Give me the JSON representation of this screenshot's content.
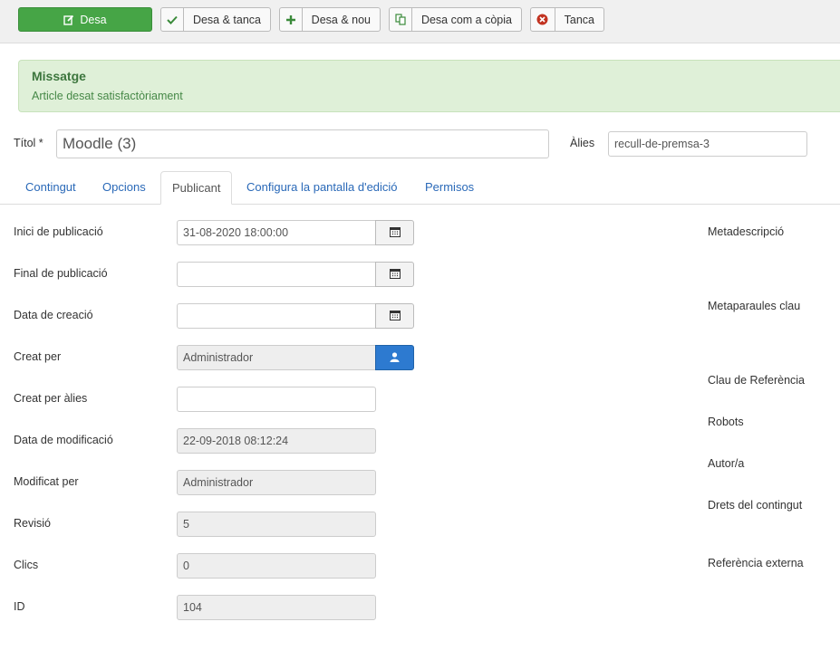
{
  "toolbar": {
    "save": "Desa",
    "save_close": "Desa & tanca",
    "save_new": "Desa & nou",
    "save_copy": "Desa com a còpia",
    "close": "Tanca"
  },
  "alert": {
    "heading": "Missatge",
    "text": "Article desat satisfactòriament"
  },
  "title": {
    "label": "Títol *",
    "value": "Moodle (3)"
  },
  "alias": {
    "label": "Àlies",
    "value": "recull-de-premsa-3"
  },
  "tabs": [
    {
      "label": "Contingut"
    },
    {
      "label": "Opcions"
    },
    {
      "label": "Publicant"
    },
    {
      "label": "Configura la pantalla d'edició"
    },
    {
      "label": "Permisos"
    }
  ],
  "active_tab": "Publicant",
  "fields": {
    "publish_up": {
      "label": "Inici de publicació",
      "value": "31-08-2020 18:00:00"
    },
    "publish_down": {
      "label": "Final de publicació",
      "value": ""
    },
    "created": {
      "label": "Data de creació",
      "value": ""
    },
    "created_by": {
      "label": "Creat per",
      "value": "Administrador"
    },
    "created_by_alias": {
      "label": "Creat per àlies",
      "value": ""
    },
    "modified": {
      "label": "Data de modificació",
      "value": "22-09-2018 08:12:24"
    },
    "modified_by": {
      "label": "Modificat per",
      "value": "Administrador"
    },
    "version": {
      "label": "Revisió",
      "value": "5"
    },
    "hits": {
      "label": "Clics",
      "value": "0"
    },
    "id": {
      "label": "ID",
      "value": "104"
    }
  },
  "meta": {
    "description": "Metadescripció",
    "keywords": "Metaparaules clau",
    "reference_key": "Clau de Referència",
    "robots": "Robots",
    "author": "Autor/a",
    "rights": "Drets del contingut",
    "external_reference": "Referència externa"
  },
  "colors": {
    "primary_green": "#46a546",
    "alert_bg": "#dff0d8",
    "link_blue": "#2a69b8",
    "user_button_blue": "#2d7ad0"
  },
  "icons": {
    "save": "edit-icon",
    "save_close": "check-icon",
    "save_new": "plus-icon",
    "save_copy": "copy-icon",
    "close": "cancel-circle-icon",
    "calendar": "calendar-icon",
    "user": "user-icon"
  }
}
